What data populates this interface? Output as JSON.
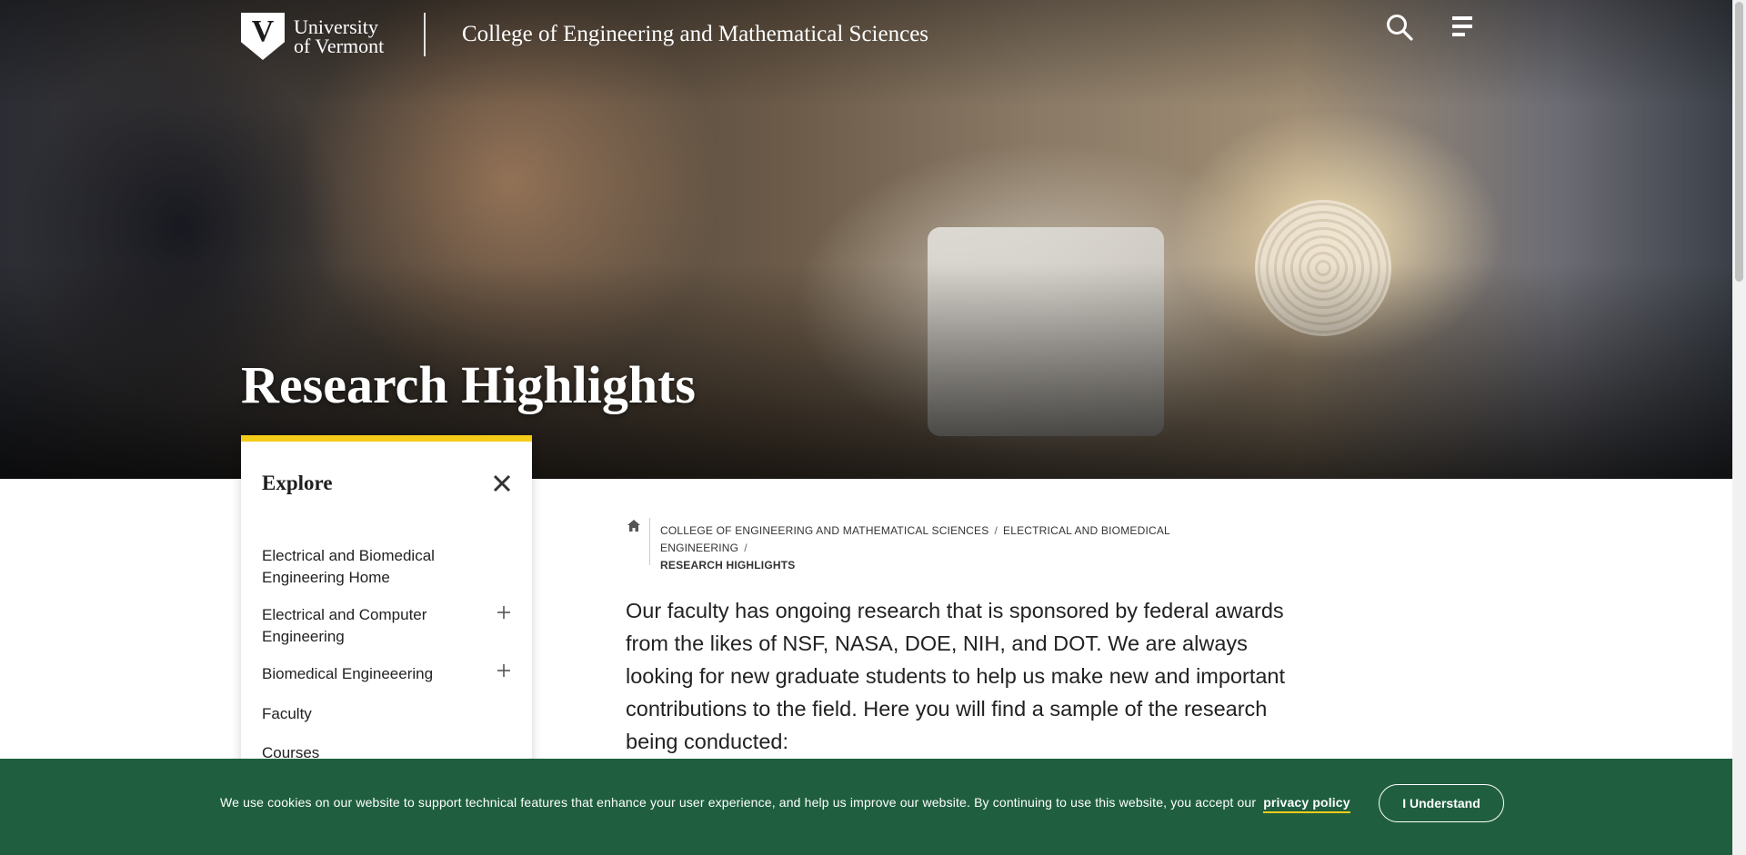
{
  "header": {
    "logo_line1": "University",
    "logo_line2": "of Vermont",
    "logo_letter": "V",
    "college_title": "College of Engineering and Mathematical Sciences",
    "search_icon": "search-icon",
    "menu_icon": "menu-icon"
  },
  "hero": {
    "title": "Research Highlights"
  },
  "explore": {
    "title": "Explore",
    "items": [
      {
        "label": "Electrical and Biomedical Engineering Home",
        "expandable": false
      },
      {
        "label": "Electrical and Computer Engineering",
        "expandable": true
      },
      {
        "label": "Biomedical Engineeering",
        "expandable": true
      },
      {
        "label": "Faculty",
        "expandable": false
      },
      {
        "label": "Courses",
        "expandable": false
      }
    ]
  },
  "breadcrumb": {
    "items": [
      "College of Engineering and Mathematical Sciences",
      "Electrical and Biomedical Engineering"
    ],
    "separator": "/",
    "current": "Research Highlights"
  },
  "content": {
    "intro": "Our faculty has ongoing research that is sponsored by federal awards from the likes of NSF, NASA, DOE, NIH, and DOT. We are always looking for new graduate students to help us make new and important contri­butions to the field. Here you will find a sample of the research being conducted:"
  },
  "cookie_banner": {
    "text": "We use cookies on our website to support technical features that enhance your user experience, and help us improve our website. By continuing to use this website, you accept our",
    "link": "privacy policy",
    "button": "I Understand"
  },
  "colors": {
    "accent_gold": "#f5cb1a",
    "banner_green": "#1f5f3f"
  }
}
